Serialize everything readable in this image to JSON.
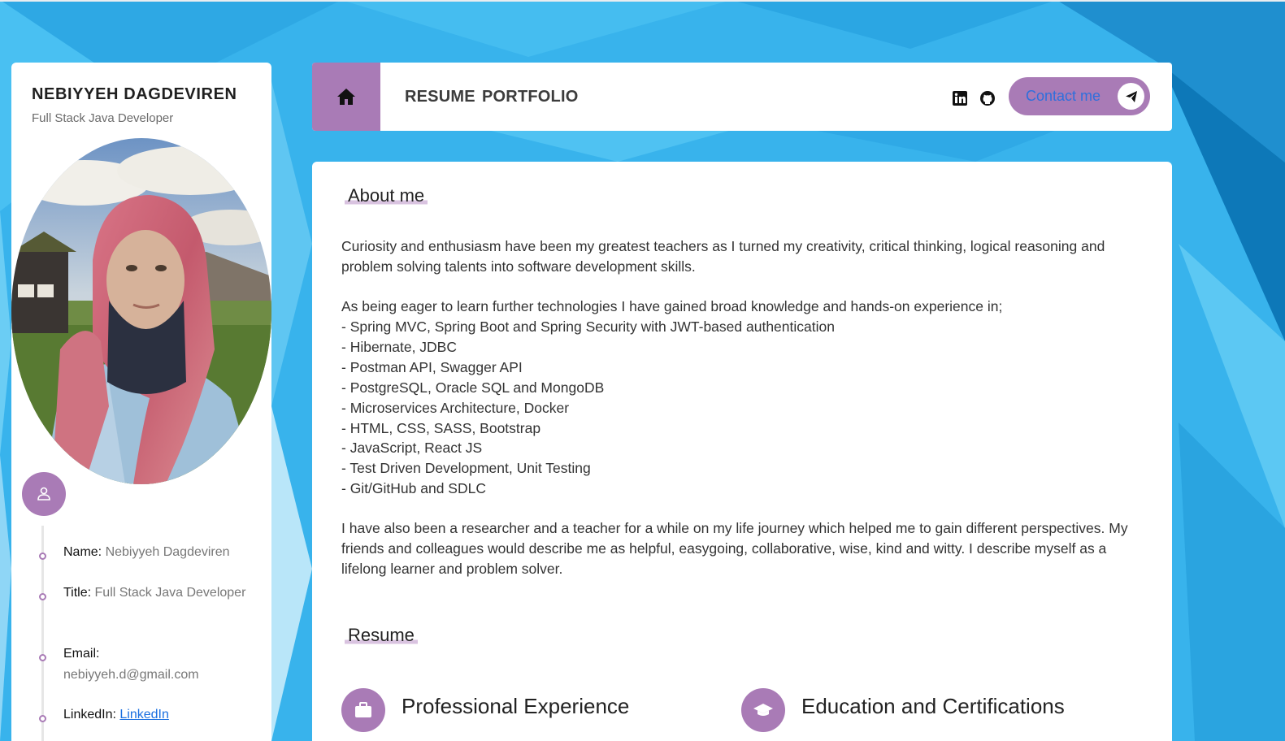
{
  "profile": {
    "name": "NEBIYYEH DAGDEVIREN",
    "role": "Full Stack Java Developer",
    "info": [
      {
        "label": "Name:",
        "value": "Nebiyyeh Dagdeviren"
      },
      {
        "label": "Title:",
        "value": "Full Stack Java Developer"
      },
      {
        "label": "Email:",
        "value": "nebiyyeh.d@gmail.com"
      },
      {
        "label": "LinkedIn:",
        "link": "LinkedIn"
      }
    ]
  },
  "nav": {
    "links": [
      "RESUME",
      "PORTFOLIO"
    ],
    "contact_label": "Contact me",
    "icons": [
      "home-icon",
      "linkedin-icon",
      "github-icon",
      "send-icon"
    ]
  },
  "about": {
    "title": "About me",
    "intro": "Curiosity and enthusiasm have been my greatest teachers as I turned my creativity, critical thinking, logical reasoning and problem solving talents into software development skills.",
    "skills_intro": "As being eager to learn further technologies I have gained broad knowledge and hands-on experience in;",
    "skills": [
      "- Spring MVC, Spring Boot and Spring Security with JWT-based authentication",
      "- Hibernate, JDBC",
      "- Postman API, Swagger API",
      "- PostgreSQL, Oracle SQL and MongoDB",
      "- Microservices Architecture, Docker",
      "- HTML, CSS, SASS, Bootstrap",
      "- JavaScript, React JS",
      "- Test Driven Development, Unit Testing",
      "- Git/GitHub and SDLC"
    ],
    "outro": "I have also been a researcher and a teacher for a while on my life journey which helped me to gain different perspectives. My friends and colleagues would describe me as helpful, easygoing, collaborative, wise, kind and witty. I describe myself as a lifelong learner and problem solver."
  },
  "resume": {
    "title": "Resume",
    "experience_title": "Professional Experience",
    "education_title": "Education and Certifications"
  },
  "colors": {
    "accent": "#a97bb6",
    "background": "#36b2ec",
    "link": "#1a6fe0"
  }
}
